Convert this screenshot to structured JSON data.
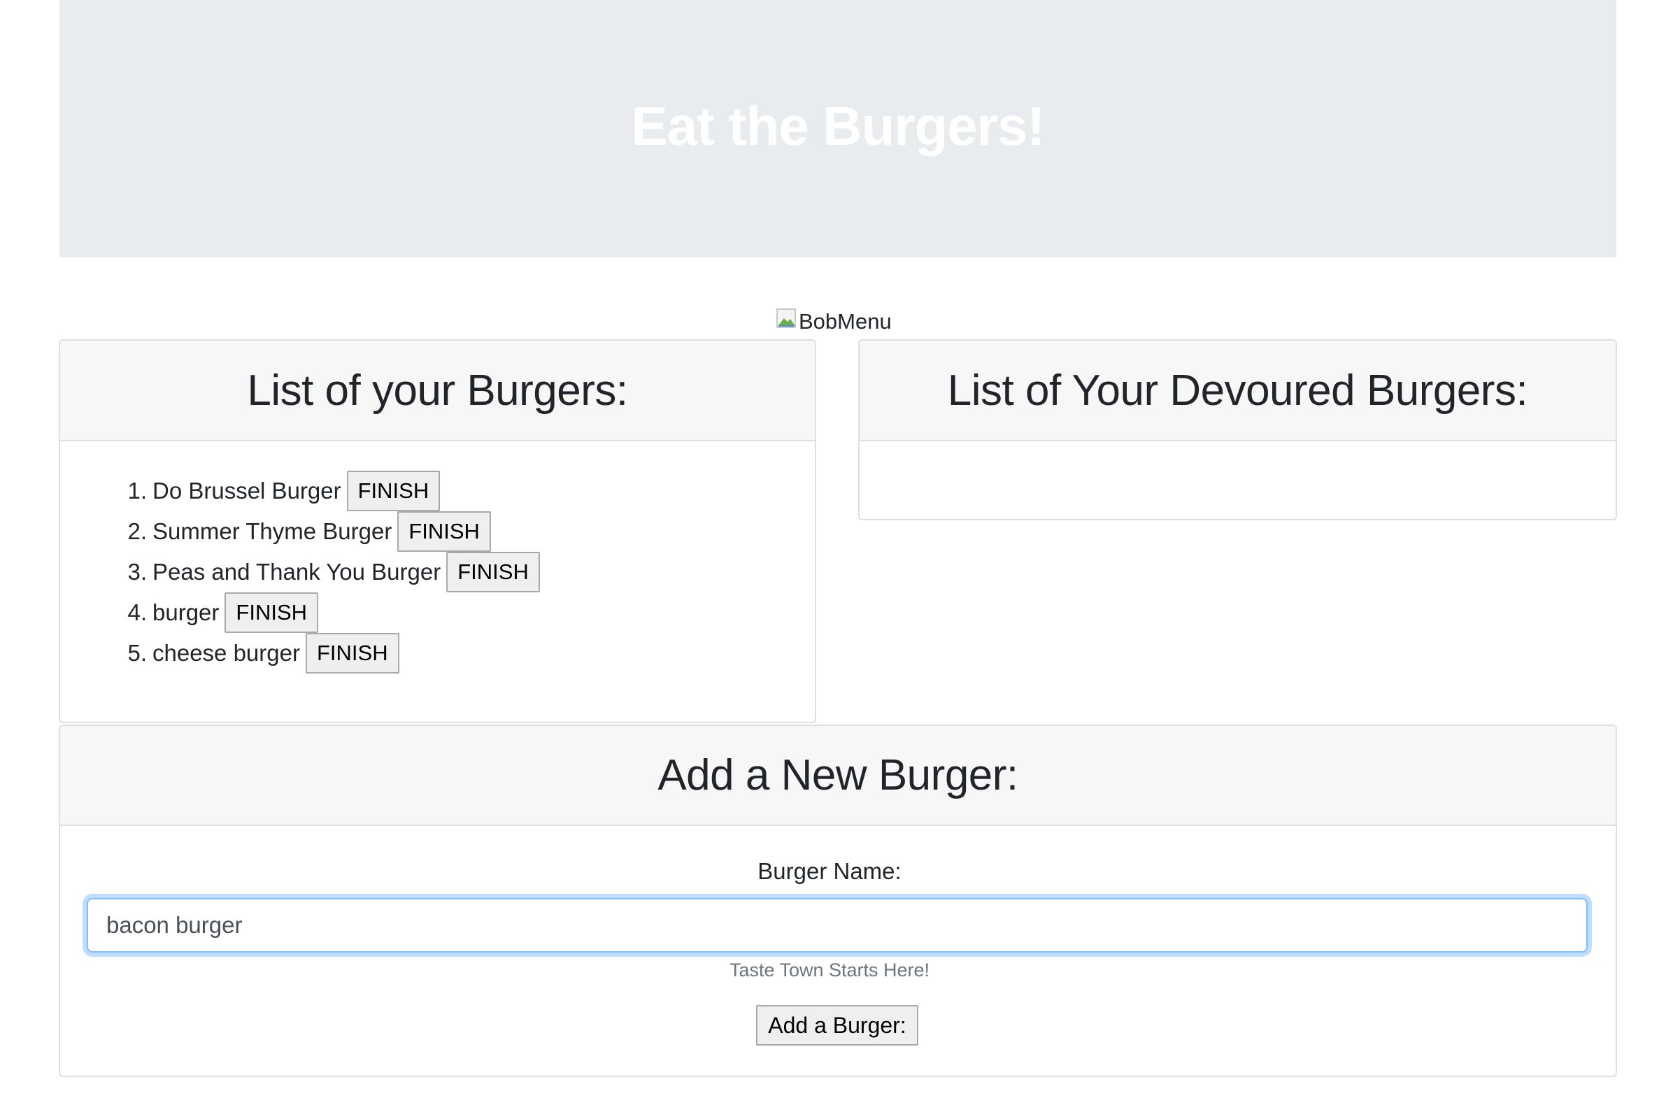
{
  "jumbotron": {
    "title": "Eat the Burgers!"
  },
  "menu_image": {
    "alt": "BobMenu"
  },
  "burgers_card": {
    "title": "List of your Burgers:",
    "items": [
      {
        "number": "1.",
        "name": "Do Brussel Burger",
        "button": "FINISH"
      },
      {
        "number": "2.",
        "name": "Summer Thyme Burger",
        "button": "FINISH"
      },
      {
        "number": "3.",
        "name": "Peas and Thank You Burger",
        "button": "FINISH"
      },
      {
        "number": "4.",
        "name": "burger",
        "button": "FINISH"
      },
      {
        "number": "5.",
        "name": "cheese burger",
        "button": "FINISH"
      }
    ]
  },
  "devoured_card": {
    "title": "List of Your Devoured Burgers:",
    "items": []
  },
  "add_card": {
    "title": "Add a New Burger:",
    "label": "Burger Name:",
    "input_value": "bacon burger",
    "help_text": "Taste Town Starts Here!",
    "submit_label": "Add a Burger:"
  }
}
